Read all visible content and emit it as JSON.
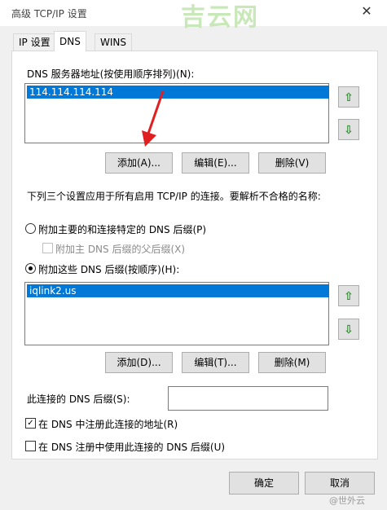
{
  "window": {
    "title": "高级 TCP/IP 设置",
    "watermark": "吉云网"
  },
  "tabs": [
    {
      "label": "IP 设置"
    },
    {
      "label": "DNS"
    },
    {
      "label": "WINS"
    }
  ],
  "dns_servers": {
    "label": "DNS 服务器地址(按使用顺序排列)(N):",
    "items": [
      "114.114.114.114"
    ],
    "add_label": "添加(A)...",
    "edit_label": "编辑(E)...",
    "delete_label": "删除(V)"
  },
  "settings_note": "下列三个设置应用于所有启用 TCP/IP 的连接。要解析不合格的名称:",
  "options": {
    "primary_suffix_label": "附加主要的和连接特定的 DNS 后缀(P)",
    "parent_suffix_label": "附加主 DNS 后缀的父后缀(X)",
    "these_suffixes_label": "附加这些 DNS 后缀(按顺序)(H):"
  },
  "suffixes": {
    "items": [
      "iqlink2.us"
    ],
    "add_label": "添加(D)...",
    "edit_label": "编辑(T)...",
    "delete_label": "删除(M)"
  },
  "connection_suffix": {
    "label": "此连接的 DNS 后缀(S):",
    "value": ""
  },
  "register": {
    "register_address_label": "在 DNS 中注册此连接的地址(R)",
    "use_suffix_label": "在 DNS 注册中使用此连接的 DNS 后缀(U)",
    "register_address_checked": true,
    "use_suffix_checked": false
  },
  "footer": {
    "ok_label": "确定",
    "cancel_label": "取消",
    "watermark": "@世外云"
  },
  "icons": {
    "up": "arrow-up-icon",
    "down": "arrow-down-icon",
    "close": "close-icon",
    "annotation": "red-arrow-annotation"
  },
  "colors": {
    "selection": "#0078d7",
    "arrow_green": "#2f8a2f",
    "annotation_red": "#e02020"
  }
}
